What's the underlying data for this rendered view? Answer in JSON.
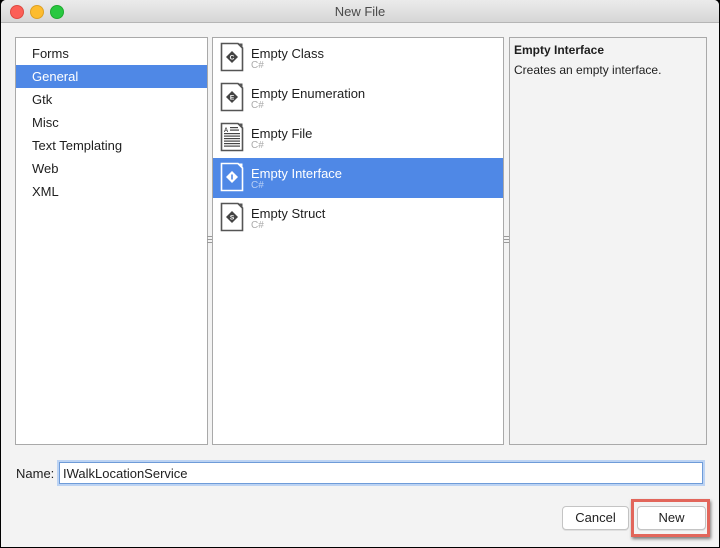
{
  "window": {
    "title": "New File"
  },
  "categories": {
    "items": [
      {
        "label": "Forms",
        "selected": false
      },
      {
        "label": "General",
        "selected": true
      },
      {
        "label": "Gtk",
        "selected": false
      },
      {
        "label": "Misc",
        "selected": false
      },
      {
        "label": "Text Templating",
        "selected": false
      },
      {
        "label": "Web",
        "selected": false
      },
      {
        "label": "XML",
        "selected": false
      }
    ]
  },
  "templates": {
    "items": [
      {
        "name": "Empty Class",
        "language": "C#",
        "icon": "class-icon",
        "glyph": "C",
        "selected": false
      },
      {
        "name": "Empty Enumeration",
        "language": "C#",
        "icon": "enum-icon",
        "glyph": "E",
        "selected": false
      },
      {
        "name": "Empty File",
        "language": "C#",
        "icon": "text-file-icon",
        "glyph": "A",
        "selected": false
      },
      {
        "name": "Empty Interface",
        "language": "C#",
        "icon": "interface-icon",
        "glyph": "I",
        "selected": true
      },
      {
        "name": "Empty Struct",
        "language": "C#",
        "icon": "struct-icon",
        "glyph": "S",
        "selected": false
      }
    ]
  },
  "description": {
    "title": "Empty Interface",
    "text": "Creates an empty interface."
  },
  "name_field": {
    "label": "Name:",
    "value": "IWalkLocationService"
  },
  "buttons": {
    "cancel": "Cancel",
    "new": "New"
  },
  "colors": {
    "selection": "#4f88e6",
    "highlight_border": "#e2665b"
  }
}
